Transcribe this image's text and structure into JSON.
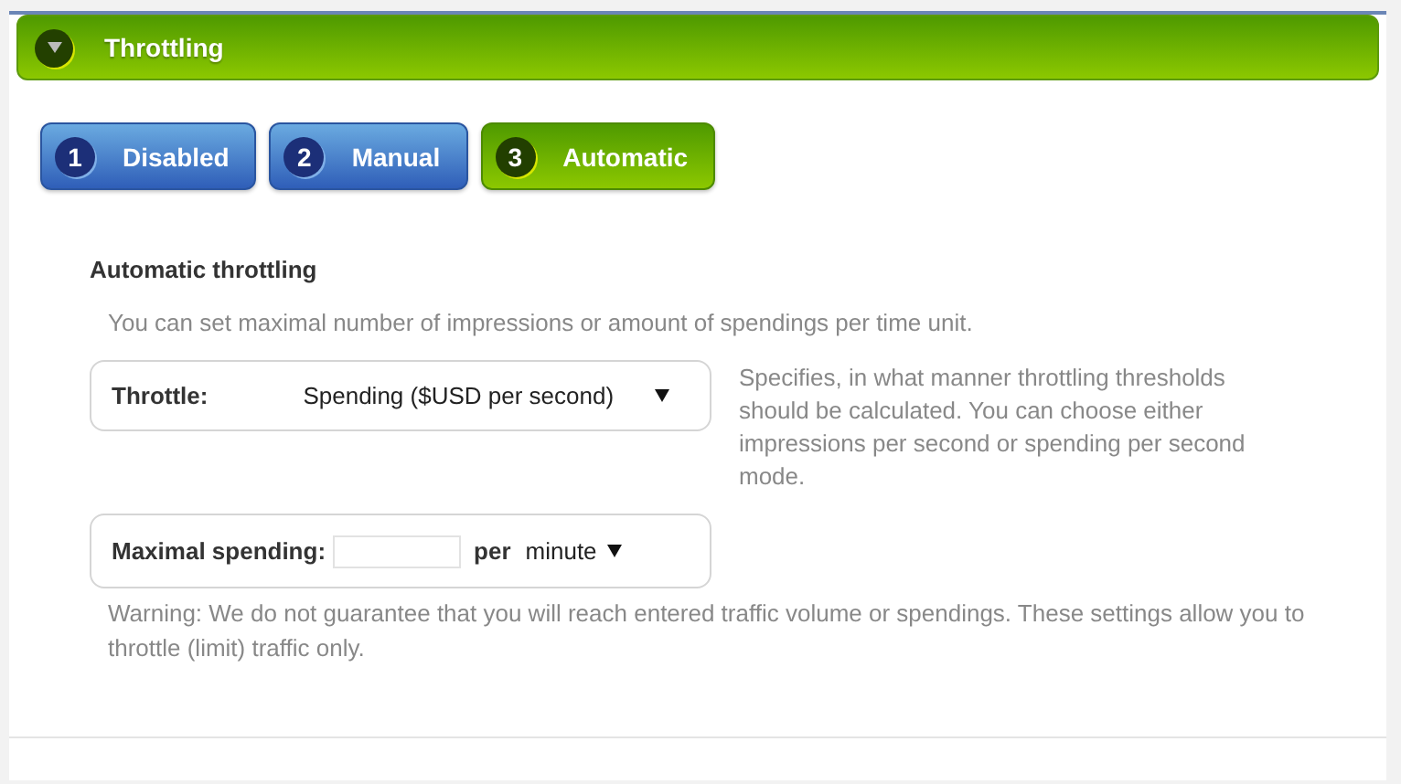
{
  "panel": {
    "title": "Throttling",
    "expanded": true
  },
  "steps": [
    {
      "number": "1",
      "label": "Disabled",
      "selected": false
    },
    {
      "number": "2",
      "label": "Manual",
      "selected": false
    },
    {
      "number": "3",
      "label": "Automatic",
      "selected": true
    }
  ],
  "section": {
    "title": "Automatic throttling",
    "intro": "You can set maximal number of impressions or amount of spendings per time unit."
  },
  "throttle_field": {
    "label": "Throttle:",
    "value": "Spending ($USD per second)",
    "help": "Specifies, in what manner throttling thresholds should be calculated. You can choose either impressions per second or spending per second mode."
  },
  "spending_field": {
    "label": "Maximal spending:",
    "per": "per",
    "unit": "minute"
  },
  "warning": "Warning: We do not guarantee that you will reach entered traffic volume or spendings. These settings allow you to throttle (limit) traffic only."
}
